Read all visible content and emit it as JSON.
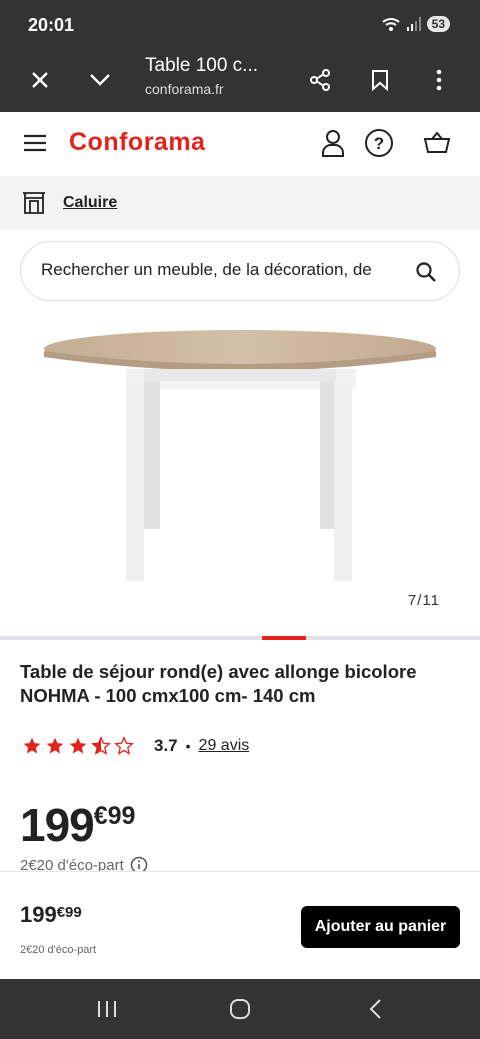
{
  "status_bar": {
    "time": "20:01",
    "battery": "53"
  },
  "browser": {
    "tab_title": "Table 100 c...",
    "url": "conforama.fr"
  },
  "header": {
    "logo": "Conforama"
  },
  "store": {
    "name": "Caluire"
  },
  "search": {
    "placeholder": "Rechercher un meuble, de la décoration, de"
  },
  "gallery": {
    "counter": "7/11",
    "current_index": 7,
    "total": 11
  },
  "product": {
    "title": "Table de séjour rond(e) avec allonge bicolore NOHMA - 100 cmx100 cm- 140 cm",
    "rating": "3.7",
    "rating_separator": "•",
    "reviews": "29 avis",
    "price_int": "199",
    "price_dec": "€99",
    "eco_part": "2€20 d'éco-part"
  },
  "sticky": {
    "price_int": "199",
    "price_dec": "€99",
    "eco_part": "2€20 d'éco-part",
    "cta": "Ajouter au panier"
  },
  "colors": {
    "brand": "#e2231a",
    "chrome": "#333333",
    "cta": "#000000"
  }
}
